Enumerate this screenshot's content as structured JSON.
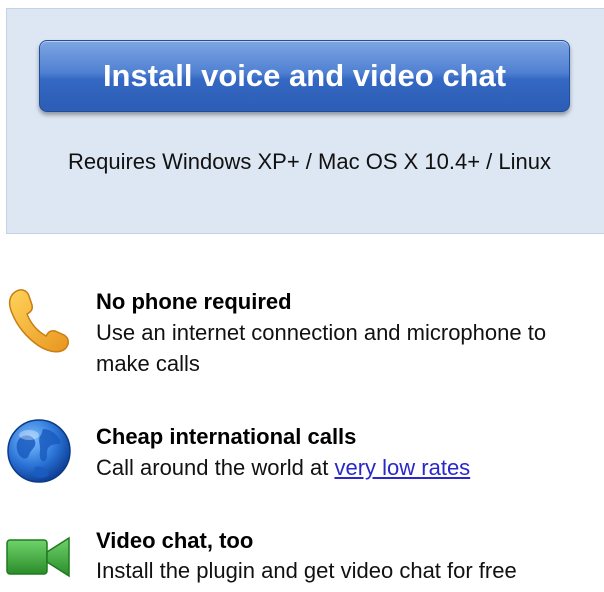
{
  "install": {
    "button_label": "Install voice and video chat",
    "requirements": "Requires Windows XP+ / Mac OS X 10.4+ / Linux"
  },
  "features": [
    {
      "icon": "phone-icon",
      "title": "No phone required",
      "description": "Use an internet connection and microphone to make calls"
    },
    {
      "icon": "globe-icon",
      "title": "Cheap international calls",
      "description_prefix": "Call around the world at ",
      "link_text": "very low rates"
    },
    {
      "icon": "video-camera-icon",
      "title": "Video chat, too",
      "description": "Install the plugin and get video chat for free"
    }
  ],
  "colors": {
    "panel_background": "#dde6f3",
    "button_blue": "#3468c2",
    "link_blue": "#2a28c9",
    "phone_orange": "#f2a93b",
    "globe_blue": "#1f62c8",
    "camera_green": "#3fae3f"
  }
}
